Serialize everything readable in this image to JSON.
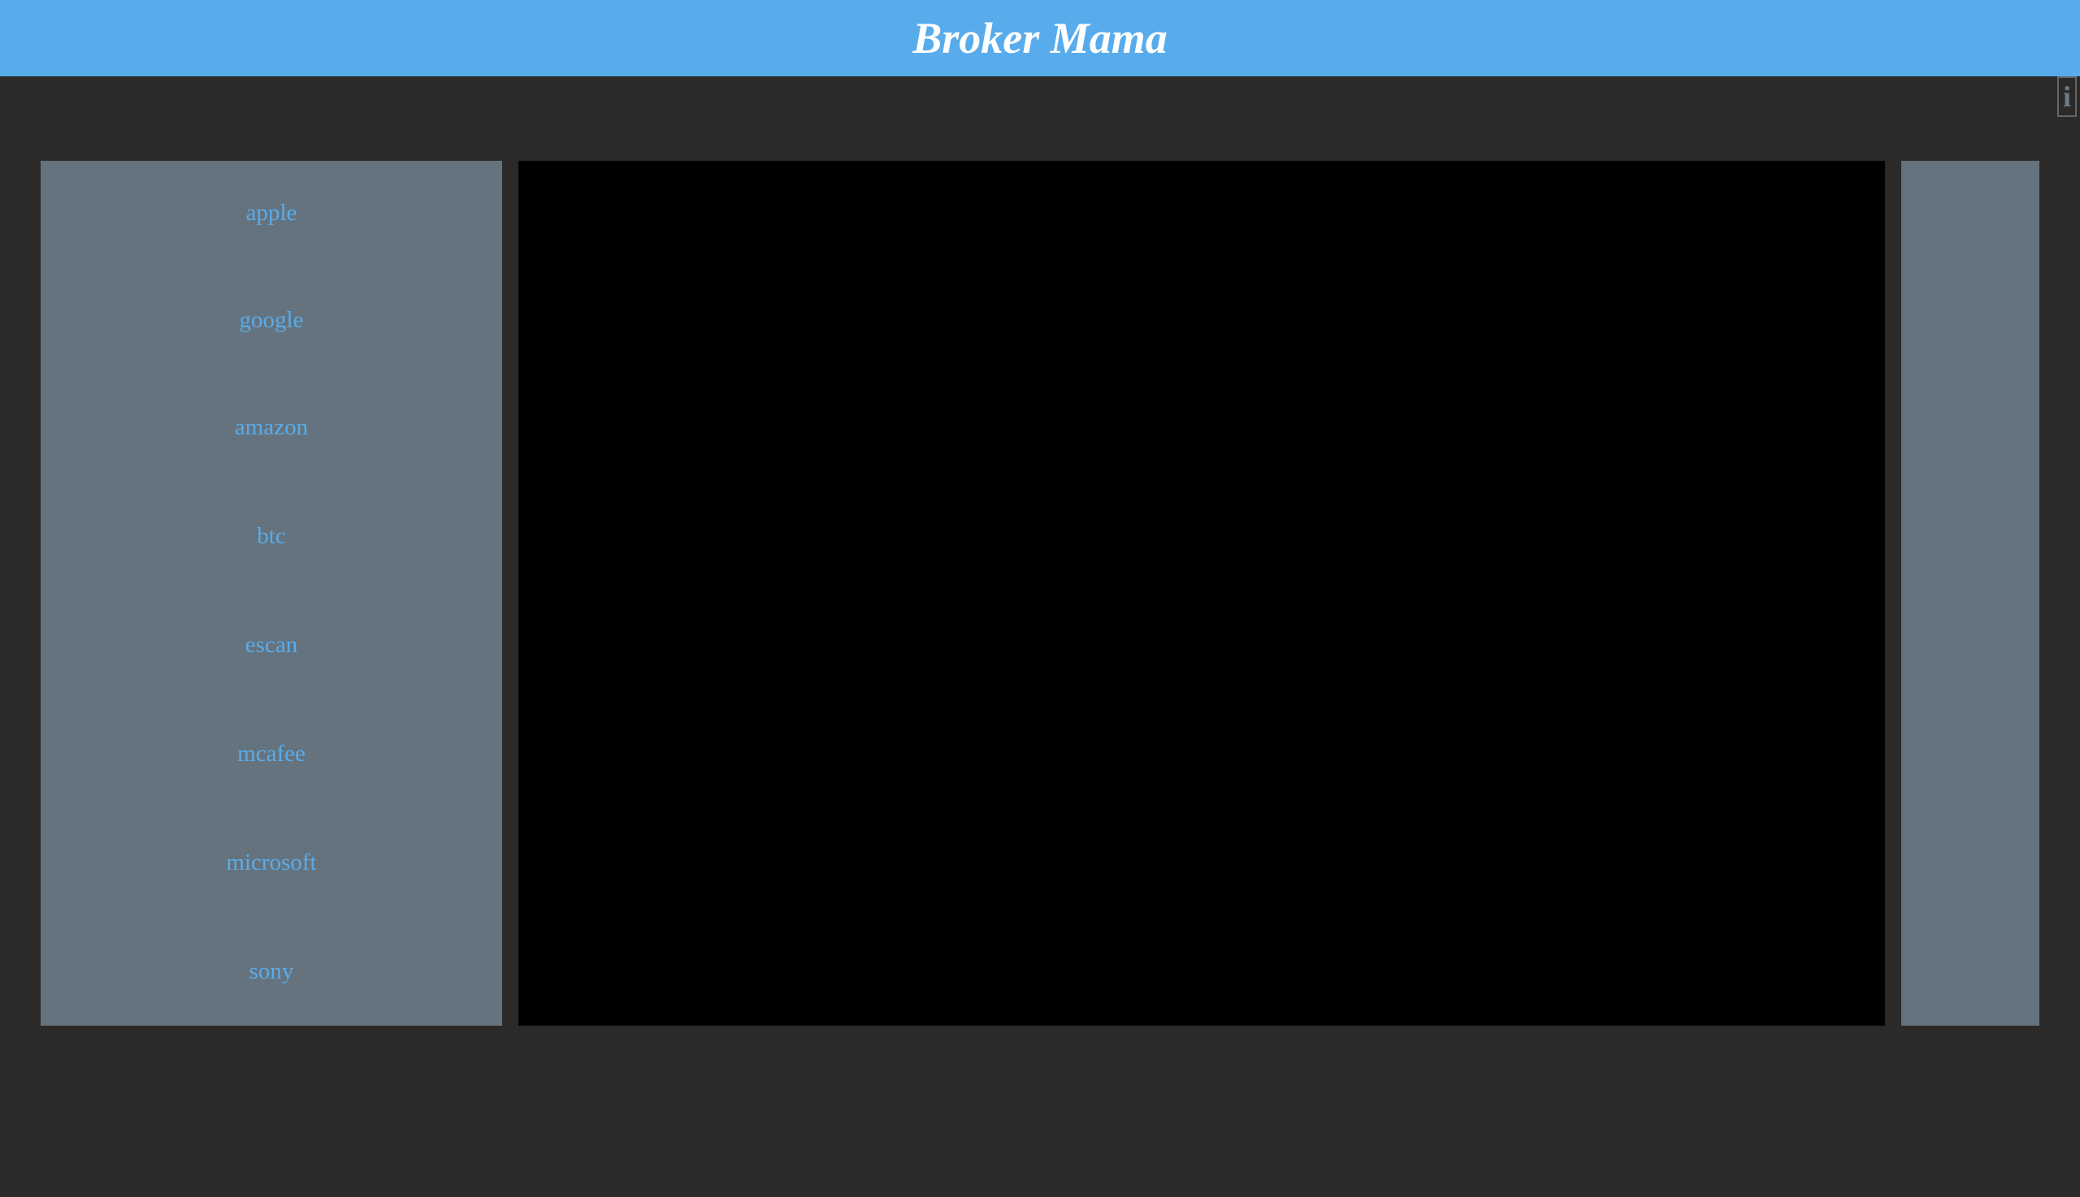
{
  "header": {
    "title": "Broker Mama"
  },
  "info_icon": "info-icon",
  "sidebar": {
    "items": [
      {
        "label": "apple"
      },
      {
        "label": "google"
      },
      {
        "label": "amazon"
      },
      {
        "label": "btc"
      },
      {
        "label": "escan"
      },
      {
        "label": "mcafee"
      },
      {
        "label": "microsoft"
      },
      {
        "label": "sony"
      }
    ]
  },
  "colors": {
    "header": "#58acec",
    "background": "#2b2a28",
    "panel": "#65737e",
    "link": "#58acec"
  }
}
